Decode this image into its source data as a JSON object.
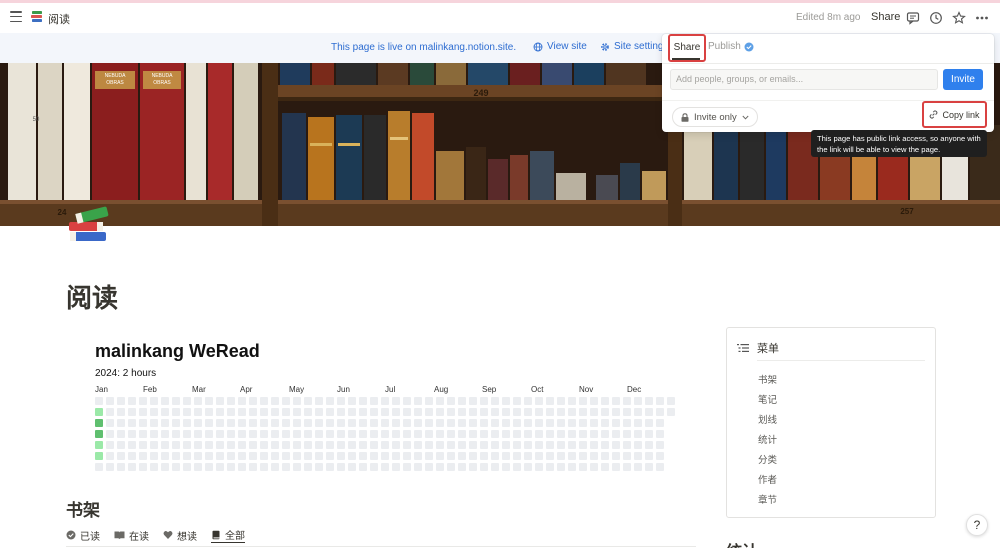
{
  "topbar": {
    "breadcrumb": "阅读",
    "edited": "Edited 8m ago",
    "share_label": "Share",
    "icons": [
      "menu-icon",
      "comment-icon",
      "history-icon",
      "star-icon",
      "more-icon"
    ]
  },
  "banner": {
    "text": "This page is live on malinkang.notion.site.",
    "view_site": "View site",
    "site_settings": "Site settings"
  },
  "cover": {
    "shelf_labels": [
      "249",
      "24",
      "257"
    ],
    "spine_texts": [
      "NEBUDA OBRAS COMPLETAS",
      "NEBUDA OBRAS COMPLETAS II",
      "50"
    ]
  },
  "page": {
    "title": "阅读"
  },
  "weread": {
    "title": "malinkang WeRead",
    "year_summary": "2024: 2 hours",
    "months": [
      "Jan",
      "Feb",
      "Mar",
      "Apr",
      "May",
      "Jun",
      "Jul",
      "Aug",
      "Sep",
      "Oct",
      "Nov",
      "Dec"
    ],
    "colors": {
      "empty": "#ebedf0",
      "light": "#9be9a8",
      "mid": "#5fbf6f"
    },
    "week_columns": 53,
    "active_cells": [
      {
        "col": 0,
        "row": 1,
        "level": "light"
      },
      {
        "col": 0,
        "row": 2,
        "level": "mid"
      },
      {
        "col": 0,
        "row": 3,
        "level": "mid"
      },
      {
        "col": 0,
        "row": 4,
        "level": "light"
      },
      {
        "col": 0,
        "row": 5,
        "level": "light"
      }
    ]
  },
  "bookshelf": {
    "heading": "书架",
    "tabs": [
      {
        "label": "已读",
        "icon": "check-circle-icon",
        "active": false
      },
      {
        "label": "在读",
        "icon": "book-open-icon",
        "active": false
      },
      {
        "label": "想读",
        "icon": "heart-icon",
        "active": false
      },
      {
        "label": "全部",
        "icon": "book-icon",
        "active": true
      }
    ]
  },
  "toc": {
    "heading": "菜单",
    "items": [
      "书架",
      "笔记",
      "划线",
      "统计",
      "分类",
      "作者",
      "章节"
    ]
  },
  "stats_heading": "统计",
  "help_label": "?",
  "share_popover": {
    "tab_share": "Share",
    "tab_publish": "Publish",
    "placeholder": "Add people, groups, or emails...",
    "invite_button": "Invite",
    "access_label": "Invite only",
    "copy_link": "Copy link",
    "tooltip": "This page has public link access, so anyone with the link will be able to view the page.",
    "accent": "#2f80ed",
    "highlight": "#d94141"
  }
}
